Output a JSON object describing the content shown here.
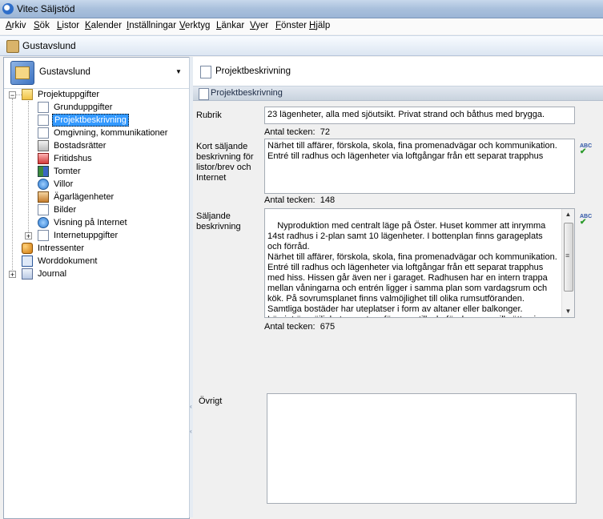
{
  "app": {
    "title": "Vitec Säljstöd"
  },
  "menu": [
    "Arkiv",
    "Sök",
    "Listor",
    "Kalender",
    "Inställningar",
    "Verktyg",
    "Länkar",
    "Vyer",
    "Fönster",
    "Hjälp"
  ],
  "window": {
    "title": "Gustavslund"
  },
  "left": {
    "selector_label": "Gustavslund",
    "tree": {
      "root": "Projektuppgifter",
      "children": [
        "Grunduppgifter",
        "Projektbeskrivning",
        "Omgivning, kommunikationer",
        "Bostadsrätter",
        "Fritidshus",
        "Tomter",
        "Villor",
        "Ägarlägenheter",
        "Bilder",
        "Visning på Internet",
        "Internetuppgifter"
      ],
      "others": [
        "Intressenter",
        "Worddokument",
        "Journal"
      ]
    },
    "selected": "Projektbeskrivning"
  },
  "right": {
    "header": "Projektbeskrivning",
    "section": "Projektbeskrivning",
    "counter_label": "Antal tecken:",
    "fields": {
      "rubrik": {
        "label": "Rubrik",
        "value": "23 lägenheter, alla med sjöutsikt. Privat strand och båthus med brygga.",
        "count": "72"
      },
      "kort": {
        "label": "Kort säljande beskrivning för listor/brev och Internet",
        "value": "Närhet till affärer, förskola, skola, fina promenadvägar och kommunikation.\nEntré till radhus och lägenheter via loftgångar från ett separat trapphus",
        "count": "148"
      },
      "saljande": {
        "label": "Säljande beskrivning",
        "value": "Nyproduktion med centralt läge på Öster. Huset kommer att inrymma 14st radhus i 2-plan samt 10 lägenheter. I bottenplan finns garageplats och förråd.\nNärhet till affärer, förskola, skola, fina promenadvägar och kommunikation.\nEntré till radhus och lägenheter via loftgångar från ett separat trapphus med hiss. Hissen går även ner i garaget. Radhusen har en intern trappa mellan våningarna och entrén ligger i samma plan som vardagsrum och kök. På sovrumsplanet finns valmöjlighet till olika rumsutföranden.\nSamtliga bostäder har uteplatser i form av altaner eller balkonger.\nI övrigt är möjligheterna stora för egna tillval - för den som vill sätta sin egen prägel på boendet.",
        "count": "675"
      },
      "ovrigt": {
        "label": "Övrigt",
        "value": ""
      }
    },
    "spellcheck_icon": "spellcheck-abc-icon"
  }
}
